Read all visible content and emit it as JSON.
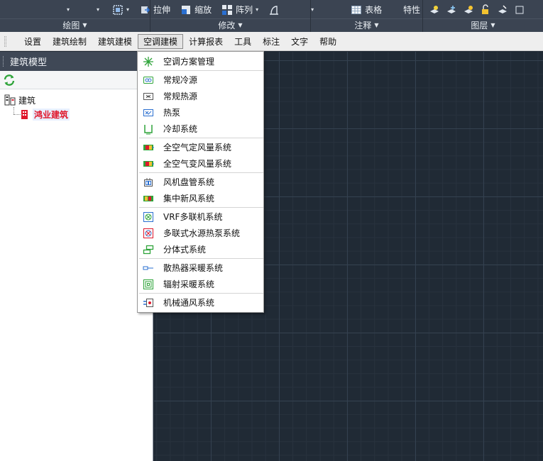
{
  "ribbon": {
    "buttons": {
      "stretch": "拉伸",
      "scale": "缩放",
      "array": "阵列",
      "table": "表格",
      "properties": "特性"
    },
    "groups": {
      "draw": "绘图",
      "modify": "修改",
      "annotation": "注释",
      "layers": "图层"
    }
  },
  "menubar": {
    "items": [
      "设置",
      "建筑绘制",
      "建筑建模",
      "空调建模",
      "计算报表",
      "工具",
      "标注",
      "文字",
      "帮助"
    ],
    "active_index": 3
  },
  "panel": {
    "title": "建筑模型",
    "tree": {
      "root": "建筑",
      "child": "鸿业建筑"
    }
  },
  "dropdown": {
    "groups": [
      [
        "空调方案管理"
      ],
      [
        "常规冷源",
        "常规热源",
        "热泵",
        "冷却系统"
      ],
      [
        "全空气定风量系统",
        "全空气变风量系统"
      ],
      [
        "风机盘管系统",
        "集中新风系统"
      ],
      [
        "VRF多联机系统",
        "多联式水源热泵系统",
        "分体式系统"
      ],
      [
        "散热器采暖系统",
        "辐射采暖系统"
      ],
      [
        "机械通风系统"
      ]
    ],
    "icons": [
      [
        "snowflake-icon"
      ],
      [
        "cold-source-icon",
        "heat-source-icon",
        "heat-pump-icon",
        "cooling-system-icon"
      ],
      [
        "air-unit-icon",
        "air-unit-icon"
      ],
      [
        "fan-coil-icon",
        "fresh-air-icon"
      ],
      [
        "vrf-icon",
        "water-heat-pump-icon",
        "split-unit-icon"
      ],
      [
        "radiator-icon",
        "radiant-heating-icon"
      ],
      [
        "mechanical-ventilation-icon"
      ]
    ]
  },
  "colors": {
    "ribbon_bg": "#3b4452",
    "canvas_bg": "#202a35",
    "highlight_red": "#e0182c"
  }
}
